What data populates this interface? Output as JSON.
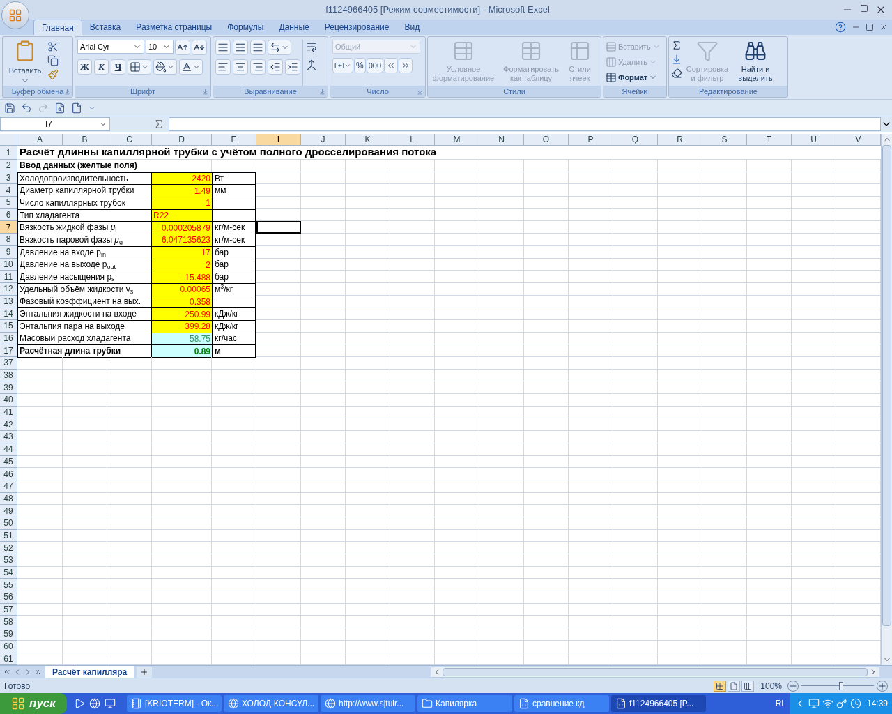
{
  "window": {
    "title": "f1124966405  [Режим совместимости] - Microsoft Excel"
  },
  "ribbon_tabs": [
    {
      "label": "Главная",
      "selected": true
    },
    {
      "label": "Вставка",
      "selected": false
    },
    {
      "label": "Разметка страницы",
      "selected": false
    },
    {
      "label": "Формулы",
      "selected": false
    },
    {
      "label": "Данные",
      "selected": false
    },
    {
      "label": "Рецензирование",
      "selected": false
    },
    {
      "label": "Вид",
      "selected": false
    }
  ],
  "clipboard": {
    "paste": "Вставить",
    "group": "Буфер обмена"
  },
  "font": {
    "name": "Arial Cyr",
    "size": "10",
    "bold": "Ж",
    "italic": "К",
    "underline": "Ч",
    "group": "Шрифт"
  },
  "alignment": {
    "group": "Выравнивание"
  },
  "number": {
    "format": "Общий",
    "format_disabled": true,
    "percent": "%",
    "thousands": "000",
    "group": "Число"
  },
  "styles": {
    "group": "Стили",
    "buttons": [
      {
        "label": "Условное форматирование",
        "disabled": true
      },
      {
        "label": "Форматировать как таблицу",
        "disabled": true
      },
      {
        "label": "Стили ячеек",
        "disabled": true
      }
    ]
  },
  "cells": {
    "group": "Ячейки",
    "buttons": [
      {
        "label": "Вставить",
        "disabled": true
      },
      {
        "label": "Удалить",
        "disabled": true
      },
      {
        "label": "Формат",
        "disabled": false
      }
    ]
  },
  "editing": {
    "group": "Редактирование",
    "buttons": [
      {
        "label": "Сортировка и фильтр",
        "disabled": true
      },
      {
        "label": "Найти и выделить",
        "disabled": false
      }
    ]
  },
  "name_box": "I7",
  "columns": [
    {
      "label": "A",
      "selected": false
    },
    {
      "label": "B",
      "selected": false
    },
    {
      "label": "C",
      "selected": false
    },
    {
      "label": "D",
      "selected": false
    },
    {
      "label": "E",
      "selected": false
    },
    {
      "label": "I",
      "selected": true
    },
    {
      "label": "J",
      "selected": false
    },
    {
      "label": "K",
      "selected": false
    },
    {
      "label": "L",
      "selected": false
    },
    {
      "label": "M",
      "selected": false
    },
    {
      "label": "N",
      "selected": false
    },
    {
      "label": "O",
      "selected": false
    },
    {
      "label": "P",
      "selected": false
    },
    {
      "label": "Q",
      "selected": false
    },
    {
      "label": "R",
      "selected": false
    },
    {
      "label": "S",
      "selected": false
    },
    {
      "label": "T",
      "selected": false
    },
    {
      "label": "U",
      "selected": false
    },
    {
      "label": "V",
      "selected": false
    }
  ],
  "rows": [
    {
      "number": "1",
      "selected": false,
      "kind": "title",
      "text": "Расчёт длинны капиллярной трубки с учётом полного дросселирования потока"
    },
    {
      "number": "2",
      "selected": false,
      "kind": "heading",
      "text": "Ввод данных (желтые поля)"
    },
    {
      "number": "3",
      "selected": false,
      "kind": "data",
      "label": "Холодопроизводительность",
      "value": "2420",
      "unit": "Вт",
      "result": false,
      "numeric": true,
      "bold": false
    },
    {
      "number": "4",
      "selected": false,
      "kind": "data",
      "label": "Диаметр капиллярной трубки",
      "value": "1.49",
      "unit": "мм",
      "result": false,
      "numeric": true,
      "bold": false
    },
    {
      "number": "5",
      "selected": false,
      "kind": "data",
      "label": "Число капиллярных трубок",
      "value": "1",
      "result": false,
      "numeric": true,
      "bold": false
    },
    {
      "number": "6",
      "selected": false,
      "kind": "data",
      "label": "Тип хладагента",
      "value": "R22",
      "result": false,
      "numeric": false,
      "bold": false
    },
    {
      "number": "7",
      "selected": true,
      "kind": "data",
      "label": "Вязкость жидкой фазы *μ*$_{l}$",
      "value": "0.000205879",
      "unit": "кг/м-сек",
      "result": false,
      "numeric": true,
      "bold": false
    },
    {
      "number": "8",
      "selected": false,
      "kind": "data",
      "label": "Вязкость паровой фазы *μ*$_{g}$",
      "value": "6.047135623",
      "unit": "кг/м-сек",
      "result": false,
      "numeric": true,
      "bold": false
    },
    {
      "number": "9",
      "selected": false,
      "kind": "data",
      "label": "Давление на входе p$_{in}$",
      "value": "17",
      "unit": "бар",
      "result": false,
      "numeric": true,
      "bold": false
    },
    {
      "number": "10",
      "selected": false,
      "kind": "data",
      "label": "Давление на выходе p$_{out}$",
      "value": "2",
      "unit": "бар",
      "result": false,
      "numeric": true,
      "bold": false
    },
    {
      "number": "11",
      "selected": false,
      "kind": "data",
      "label": "Давление насыщения p$_{s}$",
      "value": "15.488",
      "unit": "бар",
      "result": false,
      "numeric": true,
      "bold": false
    },
    {
      "number": "12",
      "selected": false,
      "kind": "data",
      "label": "Удельный объём жидкости v$_{s}$",
      "value": "0.00065",
      "unit": "м$^{3}$/кг",
      "result": false,
      "numeric": true,
      "bold": false
    },
    {
      "number": "13",
      "selected": false,
      "kind": "data",
      "label": "Фазовый коэффициент на вых.",
      "value": "0.358",
      "result": false,
      "numeric": true,
      "bold": false
    },
    {
      "number": "14",
      "selected": false,
      "kind": "data",
      "label": "Энтальпия жидкости на входе",
      "value": "250.99",
      "unit": "кДж/кг",
      "result": false,
      "numeric": true,
      "bold": false
    },
    {
      "number": "15",
      "selected": false,
      "kind": "data",
      "label": "Энтальпия пара на выходе",
      "value": "399.28",
      "unit": "кДж/кг",
      "result": false,
      "numeric": true,
      "bold": false
    },
    {
      "number": "16",
      "selected": false,
      "kind": "data",
      "label": "Масовый расход хладагента",
      "value": "58.75",
      "unit": "кг/час",
      "result": true,
      "numeric": true,
      "bold": false
    },
    {
      "number": "17",
      "selected": false,
      "kind": "data",
      "label": "Расчётная длина трубки",
      "value": "0.89",
      "unit": "м",
      "result": true,
      "numeric": true,
      "bold": true
    },
    {
      "number": "37",
      "selected": false,
      "kind": "empty"
    },
    {
      "number": "38",
      "selected": false,
      "kind": "empty"
    },
    {
      "number": "39",
      "selected": false,
      "kind": "empty"
    },
    {
      "number": "40",
      "selected": false,
      "kind": "empty"
    },
    {
      "number": "41",
      "selected": false,
      "kind": "empty"
    },
    {
      "number": "42",
      "selected": false,
      "kind": "empty"
    },
    {
      "number": "43",
      "selected": false,
      "kind": "empty"
    },
    {
      "number": "44",
      "selected": false,
      "kind": "empty"
    },
    {
      "number": "45",
      "selected": false,
      "kind": "empty"
    },
    {
      "number": "46",
      "selected": false,
      "kind": "empty"
    },
    {
      "number": "47",
      "selected": false,
      "kind": "empty"
    },
    {
      "number": "48",
      "selected": false,
      "kind": "empty"
    },
    {
      "number": "49",
      "selected": false,
      "kind": "empty"
    },
    {
      "number": "50",
      "selected": false,
      "kind": "empty"
    },
    {
      "number": "51",
      "selected": false,
      "kind": "empty"
    },
    {
      "number": "52",
      "selected": false,
      "kind": "empty"
    },
    {
      "number": "53",
      "selected": false,
      "kind": "empty"
    },
    {
      "number": "54",
      "selected": false,
      "kind": "empty"
    },
    {
      "number": "55",
      "selected": false,
      "kind": "empty"
    },
    {
      "number": "56",
      "selected": false,
      "kind": "empty"
    },
    {
      "number": "57",
      "selected": false,
      "kind": "empty"
    },
    {
      "number": "58",
      "selected": false,
      "kind": "empty"
    },
    {
      "number": "59",
      "selected": false,
      "kind": "empty"
    },
    {
      "number": "60",
      "selected": false,
      "kind": "empty"
    },
    {
      "number": "61",
      "selected": false,
      "kind": "empty"
    }
  ],
  "sheet_tabs": [
    {
      "label": "Расчёт капилляра",
      "selected": true
    }
  ],
  "status_bar": {
    "text": "Готово",
    "views": [
      {
        "selected": true
      },
      {
        "selected": false
      },
      {
        "selected": false
      }
    ],
    "zoom": "100%",
    "zoom_level": {
      "level": 0.55
    }
  },
  "taskbar": {
    "start": "пуск",
    "tasks": [
      {
        "label": "[KRIOTERM] - Ок...",
        "selected": false
      },
      {
        "label": "ХОЛОД-КОНСУЛ...",
        "selected": false
      },
      {
        "label": "http://www.sjtuir...",
        "selected": false
      },
      {
        "label": "Капилярка",
        "selected": false
      },
      {
        "label": "сравнение кд",
        "selected": false
      },
      {
        "label": "f1124966405  [P...",
        "selected": true
      }
    ],
    "language": "RL",
    "clock": "14:39"
  }
}
